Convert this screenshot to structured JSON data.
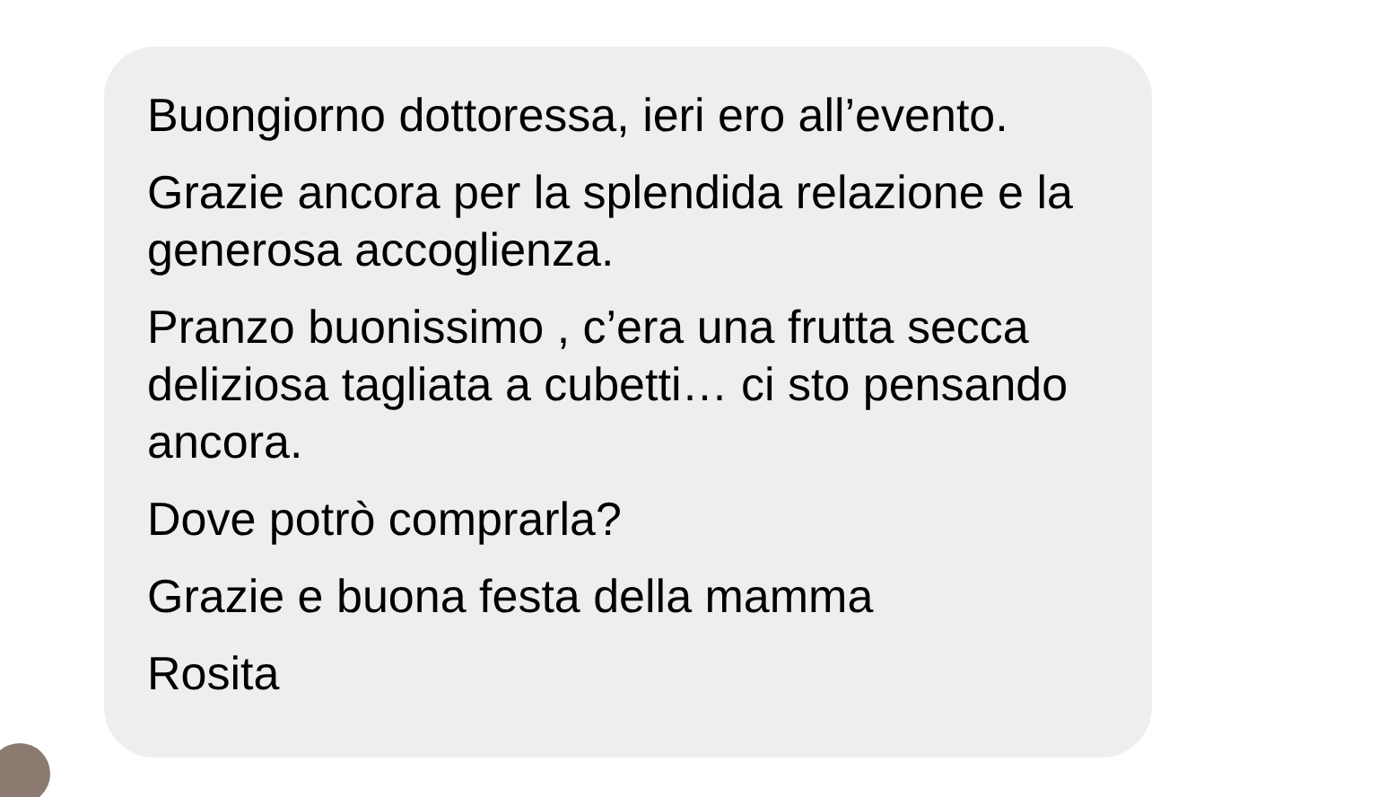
{
  "message": {
    "paragraphs": [
      "Buongiorno dottoressa, ieri ero all’evento.",
      "Grazie ancora per la splendida relazione e la generosa accoglienza.",
      "Pranzo buonissimo , c’era una frutta secca deliziosa tagliata a cubetti… ci sto pensando ancora.",
      "Dove potrò comprarla?",
      "Grazie e buona festa della mamma",
      "Rosita"
    ]
  }
}
